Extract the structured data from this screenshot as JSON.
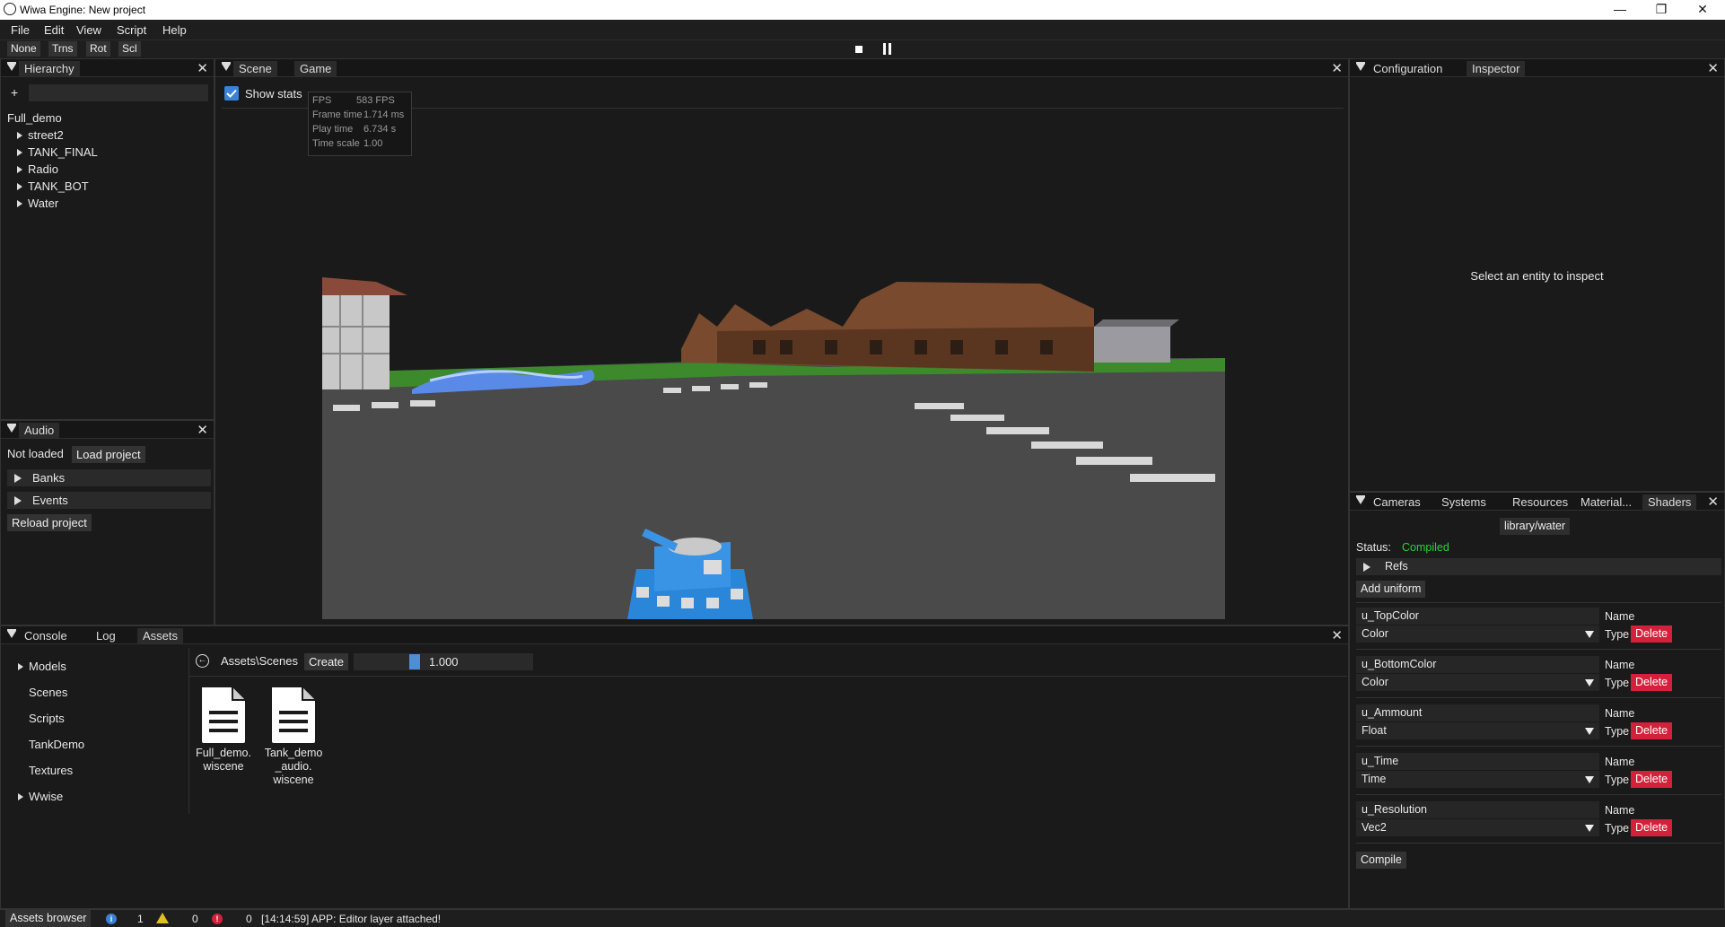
{
  "window": {
    "title": "Wiwa Engine: New project"
  },
  "menu": [
    "File",
    "Edit",
    "View",
    "Script",
    "Help"
  ],
  "toolbar": {
    "modes": [
      "None",
      "Trns",
      "Rot",
      "Scl"
    ]
  },
  "hierarchy": {
    "title": "Hierarchy",
    "add_label": "+",
    "search_value": "",
    "root": "Full_demo",
    "items": [
      "street2",
      "TANK_FINAL",
      "Radio",
      "TANK_BOT",
      "Water"
    ]
  },
  "audio": {
    "title": "Audio",
    "status": "Not loaded",
    "load_label": "Load project",
    "sections": [
      "Banks",
      "Events"
    ],
    "reload_label": "Reload project"
  },
  "scene": {
    "tabs": [
      "Scene",
      "Game"
    ],
    "show_stats_label": "Show stats",
    "show_stats_checked": true,
    "stats": [
      {
        "label": "FPS",
        "value": "583 FPS"
      },
      {
        "label": "Frame time",
        "value": "1.714 ms"
      },
      {
        "label": "Play time",
        "value": "6.734 s"
      },
      {
        "label": "Time scale",
        "value": "1.00"
      }
    ]
  },
  "inspector": {
    "tabs": [
      "Configuration",
      "Inspector"
    ],
    "placeholder": "Select an entity to inspect"
  },
  "shaders": {
    "tabs": [
      "Cameras",
      "Systems",
      "Resources",
      "Material...",
      "Shaders"
    ],
    "shader_name": "library/water",
    "status_label": "Status:",
    "status_value": "Compiled",
    "refs_label": "Refs",
    "add_uniform_label": "Add uniform",
    "name_label": "Name",
    "type_label": "Type",
    "delete_label": "Delete",
    "uniforms": [
      {
        "name": "u_TopColor",
        "type": "Color"
      },
      {
        "name": "u_BottomColor",
        "type": "Color"
      },
      {
        "name": "u_Ammount",
        "type": "Float"
      },
      {
        "name": "u_Time",
        "type": "Time"
      },
      {
        "name": "u_Resolution",
        "type": "Vec2"
      }
    ],
    "compile_label": "Compile"
  },
  "bottom": {
    "tabs": [
      "Console",
      "Log",
      "Assets"
    ],
    "folders": [
      {
        "name": "Models",
        "expandable": true
      },
      {
        "name": "Scenes",
        "expandable": false
      },
      {
        "name": "Scripts",
        "expandable": false
      },
      {
        "name": "TankDemo",
        "expandable": false
      },
      {
        "name": "Textures",
        "expandable": false
      },
      {
        "name": "Wwise",
        "expandable": true
      }
    ],
    "path": "Assets\\Scenes",
    "create_label": "Create",
    "zoom_value": "1.000",
    "zoom_fraction": 0.27,
    "files": [
      {
        "name": "Full_demo.\nwiscene"
      },
      {
        "name": "Tank_demo\n_audio.\nwiscene"
      }
    ]
  },
  "statusbar": {
    "assets_label": "Assets browser",
    "info_count": "1",
    "warn_count": "0",
    "error_count": "0",
    "message": "[14:14:59] APP: Editor layer attached!"
  },
  "colors": {
    "accent": "#4c8fd6",
    "compiled": "#27d33a",
    "delete": "#d4203a"
  }
}
